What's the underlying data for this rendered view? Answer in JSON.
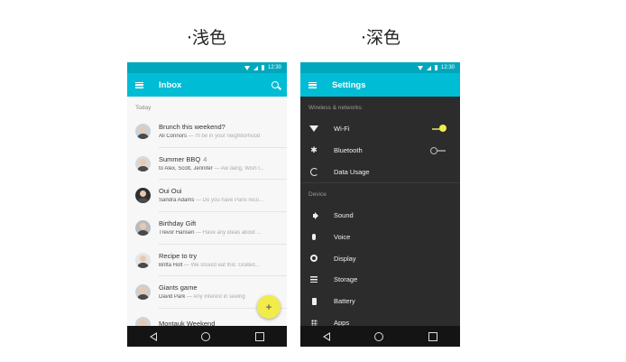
{
  "captions": {
    "light": "·浅色",
    "dark": "·深色"
  },
  "status_bar": {
    "time": "12:30"
  },
  "light_screen": {
    "title": "Inbox",
    "section": "Today",
    "messages": [
      {
        "subject": "Brunch this weekend?",
        "sender": "Ali Connors",
        "preview": " — I'll be in your neighborhood"
      },
      {
        "subject": "Summer BBQ",
        "count": "4",
        "sender": "to Alex, Scott, Jennifer",
        "preview": " — Aw dang, Wish I..."
      },
      {
        "subject": "Oui Oui",
        "sender": "Sandra Adams",
        "preview": " — Do you have Paris reco..."
      },
      {
        "subject": "Birthday Gift",
        "sender": "Trevor Hansen",
        "preview": " — Have any ideas about ..."
      },
      {
        "subject": "Recipe to try",
        "sender": "Britta Holt",
        "preview": " — We should eat this: Grated..."
      },
      {
        "subject": "Giants game",
        "sender": "David Park",
        "preview": " — Any interest in seeing"
      },
      {
        "subject": "Montauk Weekend",
        "sender": "",
        "preview": ""
      }
    ],
    "fab_label": "+"
  },
  "dark_screen": {
    "title": "Settings",
    "sections": [
      {
        "label": "Wireless & networks"
      },
      {
        "label": "Device"
      }
    ],
    "wireless_items": [
      {
        "label": "Wi-Fi",
        "icon": "wifi-icon",
        "toggle": "on"
      },
      {
        "label": "Bluetooth",
        "icon": "bluetooth-icon",
        "toggle": "off"
      },
      {
        "label": "Data Usage",
        "icon": "data-usage-icon"
      }
    ],
    "device_items": [
      {
        "label": "Sound",
        "icon": "sound-icon"
      },
      {
        "label": "Voice",
        "icon": "voice-icon"
      },
      {
        "label": "Display",
        "icon": "display-icon"
      },
      {
        "label": "Storage",
        "icon": "storage-icon"
      },
      {
        "label": "Battery",
        "icon": "battery-icon"
      },
      {
        "label": "Apps",
        "icon": "apps-icon"
      }
    ]
  },
  "colors": {
    "primary": "#00bcd4",
    "status_bar": "#00a7bd",
    "accent": "#f1ec4a",
    "dark_bg": "#2c2c2c",
    "nav_bar": "#141414"
  }
}
